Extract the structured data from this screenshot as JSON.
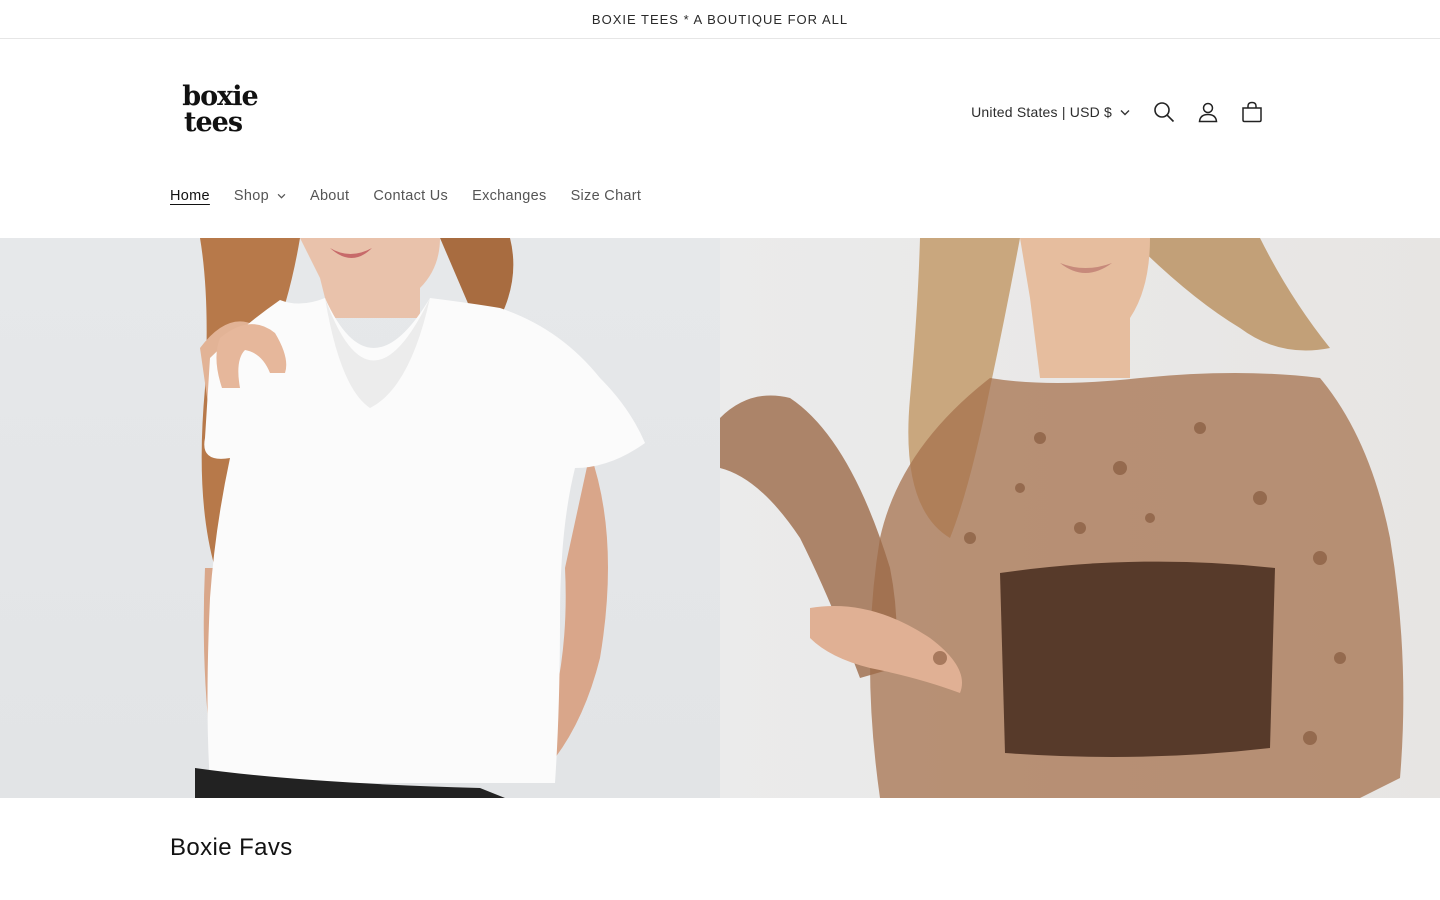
{
  "announcement": {
    "text": "BOXIE TEES * A BOUTIQUE FOR ALL"
  },
  "logo": {
    "line1": "boxie",
    "line2": "tees"
  },
  "header": {
    "country_selector": "United States | USD $",
    "icons": [
      "search-icon",
      "account-icon",
      "cart-icon"
    ]
  },
  "nav": {
    "items": [
      {
        "label": "Home",
        "active": true
      },
      {
        "label": "Shop",
        "has_dropdown": true
      },
      {
        "label": "About"
      },
      {
        "label": "Contact Us"
      },
      {
        "label": "Exchanges"
      },
      {
        "label": "Size Chart"
      }
    ]
  },
  "hero": {
    "images": [
      "white-v-neck-tee-photo",
      "brown-lace-mesh-top-photo"
    ]
  },
  "section": {
    "title": "Boxie Favs"
  },
  "colors": {
    "text": "#121212",
    "muted": "#555555",
    "border": "#e6e6e6",
    "lace": "#8b5a3c"
  }
}
